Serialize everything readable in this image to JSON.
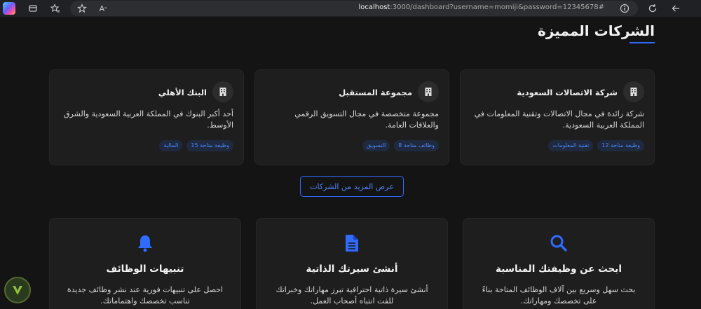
{
  "browser": {
    "url_host": "localhost",
    "url_rest": ":3000/dashboard?username=momiji&password=12345678#"
  },
  "section": {
    "title": "الشركات المميزة"
  },
  "companies": [
    {
      "name": "شركة الاتصالات السعودية",
      "description": "شركة رائدة في مجال الاتصالات وتقنية المعلومات في المملكة العربية السعودية.",
      "tags": [
        "12 وظيفة متاحة",
        "تقنية المعلومات"
      ]
    },
    {
      "name": "مجموعة المستقبل",
      "description": "مجموعة متخصصة في مجال التسويق الرقمي والعلاقات العامة.",
      "tags": [
        "8 وظائف متاحة",
        "التسويق"
      ]
    },
    {
      "name": "البنك الأهلي",
      "description": "أحد أكبر البنوك في المملكة العربية السعودية والشرق الأوسط.",
      "tags": [
        "15 وظيفة متاحة",
        "المالية"
      ]
    }
  ],
  "more_button": {
    "label": "عرض المزيد من الشركات"
  },
  "features": [
    {
      "icon": "search-icon",
      "title": "ابحث عن وظيفتك المناسبة",
      "description": "بحث سهل وسريع بين آلاف الوظائف المتاحة بناءً على تخصصك ومهاراتك."
    },
    {
      "icon": "document-icon",
      "title": "أنشئ سيرتك الذاتية",
      "description": "أنشئ سيرة ذاتية احترافية تبرز مهاراتك وخبراتك للفت انتباه أصحاب العمل."
    },
    {
      "icon": "bell-icon",
      "title": "تنبيهات الوظائف",
      "description": "احصل على تنبيهات فورية عند نشر وظائف جديدة تناسب تخصصك واهتماماتك."
    }
  ],
  "colors": {
    "accent": "#2f6bff",
    "background": "#141414",
    "card": "#1e1e1e"
  }
}
